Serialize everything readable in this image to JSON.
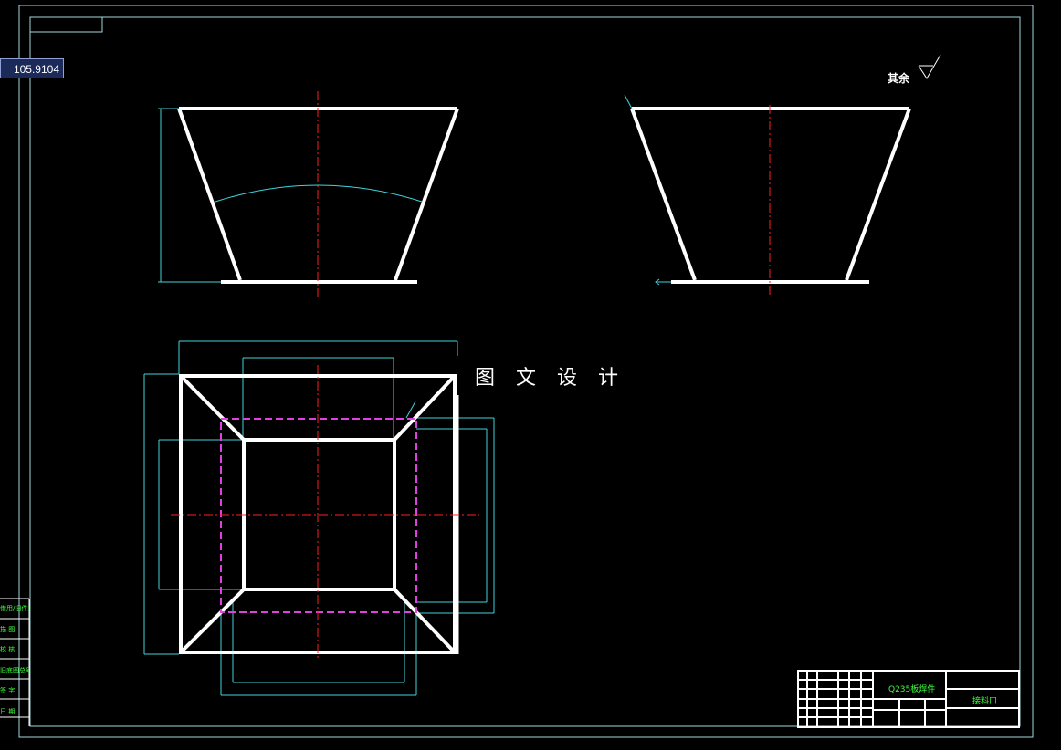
{
  "coordinate_tooltip": "105.9104",
  "watermark": "图 文 设 计",
  "roughness_note": "其余",
  "title_block": {
    "material": "Q235板焊件",
    "title_code": "接料口"
  },
  "revision_labels": [
    "借用/旧件登记",
    "描 图",
    "校 核",
    "旧底图总号",
    "签 字",
    "日 期"
  ],
  "colors": {
    "background": "#000000",
    "outline": "#ffffff",
    "centerline": "#ff2020",
    "dimension": "#3fd4dc",
    "hidden_line": "#e040e0",
    "text_green": "#3dff3d"
  }
}
